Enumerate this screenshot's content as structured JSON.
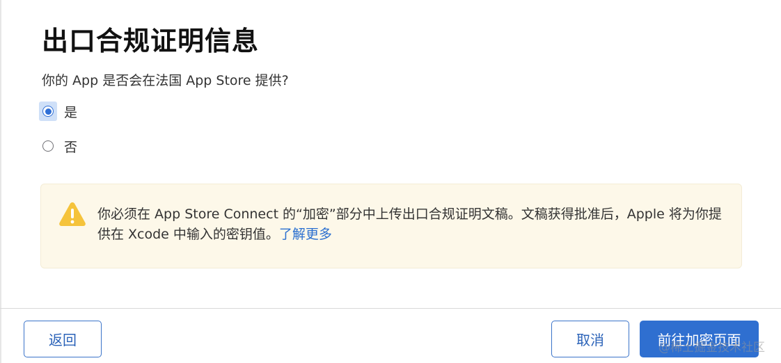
{
  "dialog": {
    "title": "出口合规证明信息",
    "question": "你的 App 是否会在法国 App Store 提供?",
    "options": [
      {
        "label": "是",
        "selected": true
      },
      {
        "label": "否",
        "selected": false
      }
    ],
    "warning": {
      "icon": "warning-triangle-icon",
      "text": "你必须在 App Store Connect 的“加密”部分中上传出口合规证明文稿。文稿获得批准后，Apple 将为你提供在 Xcode 中输入的密钥值。",
      "link_label": "了解更多"
    }
  },
  "footer": {
    "back_label": "返回",
    "cancel_label": "取消",
    "primary_label": "前往加密页面"
  },
  "watermark": "@稀土掘金技术社区",
  "colors": {
    "accent": "#2f6fd0",
    "warning_bg": "#fdf8e9",
    "warning_icon": "#f5c33b"
  }
}
